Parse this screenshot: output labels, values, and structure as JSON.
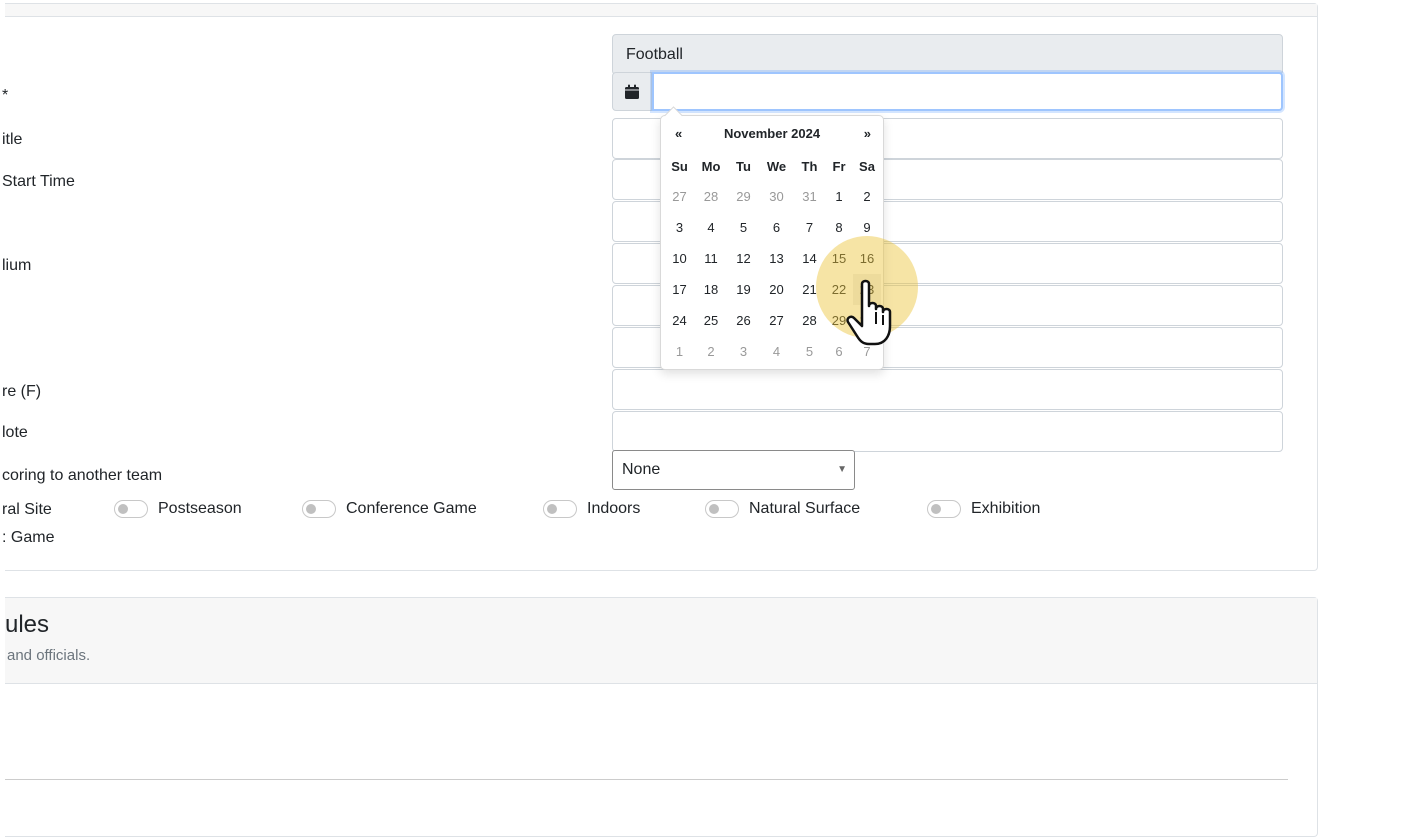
{
  "form": {
    "labels": {
      "asterisk": "*",
      "title": "itle",
      "start_time": "Start Time",
      "stadium": "lium",
      "temperature": "re (F)",
      "note": "lote",
      "scoring": "coring to another team",
      "neutral_site": "ral Site",
      "game_extra": ": Game"
    },
    "sport_value": "Football",
    "date_value": "",
    "scoring_select": {
      "selected": "None"
    },
    "toggles": [
      {
        "label": "Postseason"
      },
      {
        "label": "Conference Game"
      },
      {
        "label": "Indoors"
      },
      {
        "label": "Natural Surface"
      },
      {
        "label": "Exhibition"
      }
    ]
  },
  "datepicker": {
    "prev": "«",
    "next": "»",
    "title": "November 2024",
    "weekdays": [
      "Su",
      "Mo",
      "Tu",
      "We",
      "Th",
      "Fr",
      "Sa"
    ],
    "weeks": [
      [
        "27",
        "28",
        "29",
        "30",
        "31",
        "1",
        "2"
      ],
      [
        "3",
        "4",
        "5",
        "6",
        "7",
        "8",
        "9"
      ],
      [
        "10",
        "11",
        "12",
        "13",
        "14",
        "15",
        "16"
      ],
      [
        "17",
        "18",
        "19",
        "20",
        "21",
        "22",
        "23"
      ],
      [
        "24",
        "25",
        "26",
        "27",
        "28",
        "29",
        "30"
      ],
      [
        "1",
        "2",
        "3",
        "4",
        "5",
        "6",
        "7"
      ]
    ]
  },
  "rules_section": {
    "title": "ules",
    "subtitle": "and officials."
  },
  "icons": {
    "calendar": "calendar-icon",
    "cursor": "hand-pointer-icon"
  },
  "colors": {
    "focus_border": "#9ec5fe",
    "highlight": "#eac437"
  }
}
